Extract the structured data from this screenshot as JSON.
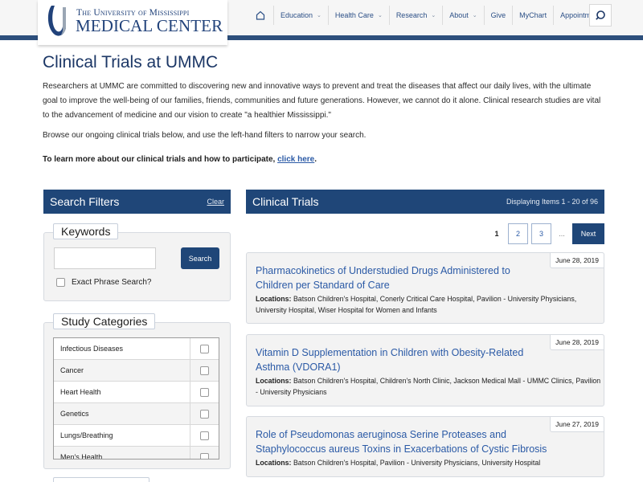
{
  "header": {
    "logo_line1": "The University of Mississippi",
    "logo_line2": "MEDICAL CENTER",
    "nav": [
      {
        "label": "Education",
        "dropdown": true
      },
      {
        "label": "Health Care",
        "dropdown": true
      },
      {
        "label": "Research",
        "dropdown": true
      },
      {
        "label": "About",
        "dropdown": true
      },
      {
        "label": "Give",
        "dropdown": false
      },
      {
        "label": "MyChart",
        "dropdown": false
      },
      {
        "label": "Appointments",
        "dropdown": false
      }
    ],
    "home_icon": "home-icon",
    "search_icon": "search-icon"
  },
  "intro": {
    "title": "Clinical Trials at UMMC",
    "paragraph": "Researchers at UMMC are committed to discovering new and innovative ways to prevent and treat the diseases that affect our daily lives, with the ultimate goal to improve the well-being of our families, friends, communities and future generations. However, we cannot do it alone. Clinical research studies are vital to the advancement of medicine and our vision to create \"a healthier Mississippi.\"",
    "browse_text": "Browse our ongoing clinical trials below, and use the left-hand filters to narrow your search.",
    "learn_more_text": "To learn more about our clinical trials and how to participate, ",
    "learn_more_link": "click here",
    "learn_more_end": "."
  },
  "filters": {
    "title": "Search Filters",
    "clear_label": "Clear",
    "keywords": {
      "legend": "Keywords",
      "input_value": "",
      "input_placeholder": "",
      "search_label": "Search",
      "exact_phrase_label": "Exact Phrase Search?",
      "exact_phrase_checked": false
    },
    "categories": {
      "legend": "Study Categories",
      "items": [
        {
          "label": "Infectious Diseases",
          "checked": false
        },
        {
          "label": "Cancer",
          "checked": false
        },
        {
          "label": "Heart Health",
          "checked": false
        },
        {
          "label": "Genetics",
          "checked": false
        },
        {
          "label": "Lungs/Breathing",
          "checked": false
        },
        {
          "label": "Men's Health",
          "checked": false
        }
      ]
    }
  },
  "trials": {
    "title": "Clinical Trials",
    "count_text": "Displaying Items 1 - 20 of 96",
    "pagination": {
      "current": "1",
      "pages": [
        "2",
        "3"
      ],
      "ellipsis": "...",
      "next_label": "Next"
    },
    "locations_label": "Locations:",
    "items": [
      {
        "date": "June 28, 2019",
        "title": "Pharmacokinetics of Understudied Drugs Administered to Children per Standard of Care",
        "locations": "Batson Children's Hospital, Conerly Critical Care Hospital, Pavilion - University Physicians, University Hospital, Wiser Hospital for Women and Infants"
      },
      {
        "date": "June 28, 2019",
        "title": "Vitamin D Supplementation in Children with Obesity-Related Asthma (VDORA1)",
        "locations": "Batson Children's Hospital, Children's North Clinic, Jackson Medical Mall - UMMC Clinics, Pavilion - University Physicians"
      },
      {
        "date": "June 27, 2019",
        "title": "Role of Pseudomonas aeruginosa Serine Proteases and Staphylococcus aureus Toxins in Exacerbations of Cystic Fibrosis",
        "locations": "Batson Children's Hospital, Pavilion - University Physicians, University Hospital"
      }
    ]
  },
  "colors": {
    "brand_navy": "#1f4678",
    "stripe": "#2d4f7c",
    "link_blue": "#2b5aa6",
    "title_navy": "#1c3766"
  }
}
